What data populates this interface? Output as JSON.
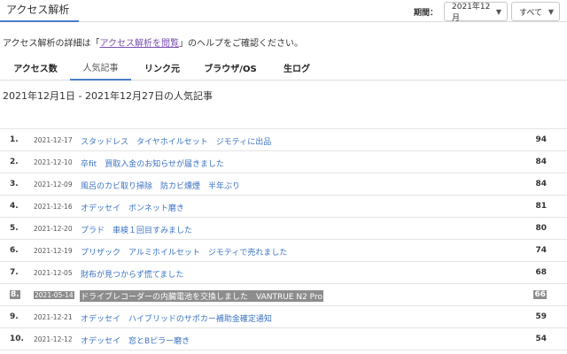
{
  "header": {
    "tab_label": "アクセス解析",
    "period_label": "期間：",
    "month_select": "2021年12月",
    "scope_select": "すべて"
  },
  "help": {
    "prefix": "アクセス解析の詳細は「",
    "link": "アクセス解析を閲覧",
    "suffix": "」のヘルプをご確認ください。"
  },
  "tabs": [
    {
      "label": "アクセス数",
      "active": false
    },
    {
      "label": "人気記事",
      "active": true
    },
    {
      "label": "リンク元",
      "active": false
    },
    {
      "label": "ブラウザ/OS",
      "active": false
    },
    {
      "label": "生ログ",
      "active": false
    }
  ],
  "range_title": "2021年12月1日 - 2021年12月27日の人気記事",
  "articles": [
    {
      "rank": "1.",
      "date": "2021-12-17",
      "title": "スタッドレス　タイヤホイルセット　ジモティに出品",
      "count": "94"
    },
    {
      "rank": "2.",
      "date": "2021-12-10",
      "title": "卒fit　買取入金のお知らせが届きました",
      "count": "84"
    },
    {
      "rank": "3.",
      "date": "2021-12-09",
      "title": "風呂のカビ取り掃除　防カビ燻煙　半年ぶり",
      "count": "84"
    },
    {
      "rank": "4.",
      "date": "2021-12-16",
      "title": "オデッセイ　ボンネット磨き",
      "count": "81"
    },
    {
      "rank": "5.",
      "date": "2021-12-20",
      "title": "プラド　車検１回目すみました",
      "count": "80"
    },
    {
      "rank": "6.",
      "date": "2021-12-19",
      "title": "プリザック　アルミホイルセット　ジモティで売れました",
      "count": "74"
    },
    {
      "rank": "7.",
      "date": "2021-12-05",
      "title": "財布が見つからず慌てました",
      "count": "68"
    },
    {
      "rank": "8.",
      "date": "2021-05-14",
      "title": "ドライブレコーダーの内臓電池を交換しました　VANTRUE N2 Pro",
      "count": "66"
    },
    {
      "rank": "9.",
      "date": "2021-12-21",
      "title": "オデッセイ　ハイブリッドのサポカー補助金確定通知",
      "count": "59"
    },
    {
      "rank": "10.",
      "date": "2021-12-12",
      "title": "オデッセイ　窓とBピラー磨き",
      "count": "54"
    }
  ]
}
